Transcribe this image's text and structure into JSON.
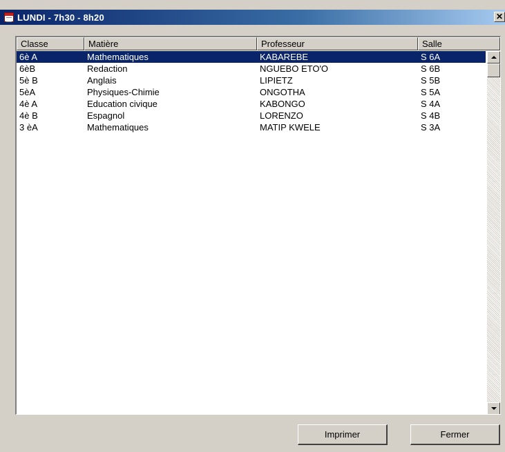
{
  "window": {
    "title": "LUNDI - 7h30 - 8h20",
    "close_glyph": "✕"
  },
  "table": {
    "columns": [
      "Classe",
      "Matière",
      "Professeur",
      "Salle"
    ],
    "rows": [
      [
        "6è A",
        "Mathematiques",
        "KABAREBE",
        "S 6A"
      ],
      [
        "6èB",
        "Redaction",
        "NGUEBO ETO'O",
        "S 6B"
      ],
      [
        "5è B",
        "Anglais",
        "LIPIETZ",
        "S 5B"
      ],
      [
        "5èA",
        "Physiques-Chimie",
        "ONGOTHA",
        "S 5A"
      ],
      [
        "4è A",
        "Education civique",
        "KABONGO",
        "S 4A"
      ],
      [
        "4è B",
        "Espagnol",
        "LORENZO",
        "S 4B"
      ],
      [
        "3 èA",
        "Mathematiques",
        "MATIP KWELE",
        "S 3A"
      ]
    ],
    "selected_row": 0
  },
  "buttons": {
    "print_label": "Imprimer",
    "close_label": "Fermer"
  },
  "colors": {
    "title_bar": "#0a246a",
    "selection": "#0a246a",
    "face": "#d4d0c8"
  }
}
